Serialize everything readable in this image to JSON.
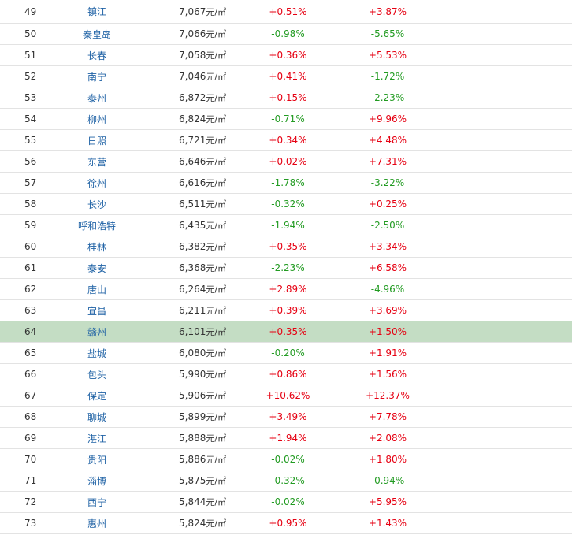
{
  "colors": {
    "up": "#e60012",
    "down": "#229b22",
    "link": "#1f62a5",
    "highlight": "#c4ddc4"
  },
  "unit": "元/㎡",
  "rows": [
    {
      "rank": "49",
      "city": "镇江",
      "price": "7,067",
      "mom": "+0.51%",
      "yoy": "+3.87%"
    },
    {
      "rank": "50",
      "city": "秦皇岛",
      "price": "7,066",
      "mom": "-0.98%",
      "yoy": "-5.65%"
    },
    {
      "rank": "51",
      "city": "长春",
      "price": "7,058",
      "mom": "+0.36%",
      "yoy": "+5.53%"
    },
    {
      "rank": "52",
      "city": "南宁",
      "price": "7,046",
      "mom": "+0.41%",
      "yoy": "-1.72%"
    },
    {
      "rank": "53",
      "city": "泰州",
      "price": "6,872",
      "mom": "+0.15%",
      "yoy": "-2.23%"
    },
    {
      "rank": "54",
      "city": "柳州",
      "price": "6,824",
      "mom": "-0.71%",
      "yoy": "+9.96%"
    },
    {
      "rank": "55",
      "city": "日照",
      "price": "6,721",
      "mom": "+0.34%",
      "yoy": "+4.48%"
    },
    {
      "rank": "56",
      "city": "东营",
      "price": "6,646",
      "mom": "+0.02%",
      "yoy": "+7.31%"
    },
    {
      "rank": "57",
      "city": "徐州",
      "price": "6,616",
      "mom": "-1.78%",
      "yoy": "-3.22%"
    },
    {
      "rank": "58",
      "city": "长沙",
      "price": "6,511",
      "mom": "-0.32%",
      "yoy": "+0.25%"
    },
    {
      "rank": "59",
      "city": "呼和浩特",
      "price": "6,435",
      "mom": "-1.94%",
      "yoy": "-2.50%"
    },
    {
      "rank": "60",
      "city": "桂林",
      "price": "6,382",
      "mom": "+0.35%",
      "yoy": "+3.34%"
    },
    {
      "rank": "61",
      "city": "泰安",
      "price": "6,368",
      "mom": "-2.23%",
      "yoy": "+6.58%"
    },
    {
      "rank": "62",
      "city": "唐山",
      "price": "6,264",
      "mom": "+2.89%",
      "yoy": "-4.96%"
    },
    {
      "rank": "63",
      "city": "宜昌",
      "price": "6,211",
      "mom": "+0.39%",
      "yoy": "+3.69%"
    },
    {
      "rank": "64",
      "city": "赣州",
      "price": "6,101",
      "mom": "+0.35%",
      "yoy": "+1.50%",
      "highlight": true
    },
    {
      "rank": "65",
      "city": "盐城",
      "price": "6,080",
      "mom": "-0.20%",
      "yoy": "+1.91%"
    },
    {
      "rank": "66",
      "city": "包头",
      "price": "5,990",
      "mom": "+0.86%",
      "yoy": "+1.56%"
    },
    {
      "rank": "67",
      "city": "保定",
      "price": "5,906",
      "mom": "+10.62%",
      "yoy": "+12.37%"
    },
    {
      "rank": "68",
      "city": "聊城",
      "price": "5,899",
      "mom": "+3.49%",
      "yoy": "+7.78%"
    },
    {
      "rank": "69",
      "city": "湛江",
      "price": "5,888",
      "mom": "+1.94%",
      "yoy": "+2.08%"
    },
    {
      "rank": "70",
      "city": "贵阳",
      "price": "5,886",
      "mom": "-0.02%",
      "yoy": "+1.80%"
    },
    {
      "rank": "71",
      "city": "淄博",
      "price": "5,875",
      "mom": "-0.32%",
      "yoy": "-0.94%"
    },
    {
      "rank": "72",
      "city": "西宁",
      "price": "5,844",
      "mom": "-0.02%",
      "yoy": "+5.95%"
    },
    {
      "rank": "73",
      "city": "惠州",
      "price": "5,824",
      "mom": "+0.95%",
      "yoy": "+1.43%"
    }
  ]
}
